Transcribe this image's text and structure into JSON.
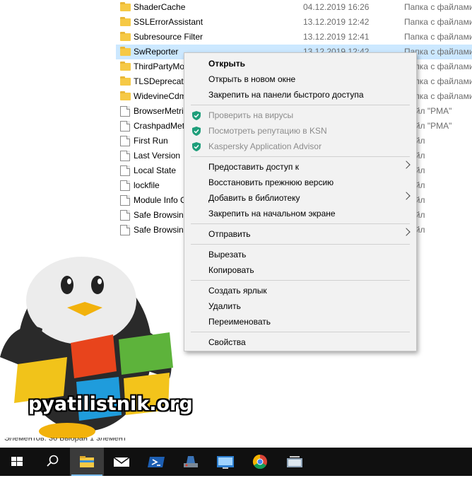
{
  "files": [
    {
      "name": "ShaderCache",
      "date": "04.12.2019 16:26",
      "type": "Папка с файлами",
      "kind": "folder"
    },
    {
      "name": "SSLErrorAssistant",
      "date": "13.12.2019 12:42",
      "type": "Папка с файлами",
      "kind": "folder"
    },
    {
      "name": "Subresource Filter",
      "date": "13.12.2019 12:41",
      "type": "Папка с файлами",
      "kind": "folder"
    },
    {
      "name": "SwReporter",
      "date": "13.12.2019 12:42",
      "type": "Папка с файлами",
      "kind": "folder",
      "selected": true
    },
    {
      "name": "ThirdPartyMo",
      "date": "",
      "type": "Папка с файлами",
      "kind": "folder"
    },
    {
      "name": "TLSDeprecatio",
      "date": "",
      "type": "Папка с файлами",
      "kind": "folder"
    },
    {
      "name": "WidevineCdm",
      "date": "",
      "type": "Папка с файлами",
      "kind": "folder"
    },
    {
      "name": "BrowserMetric",
      "date": "",
      "type": "Файл \"PMA\"",
      "kind": "file"
    },
    {
      "name": "CrashpadMetr",
      "date": "",
      "type": "Файл \"PMA\"",
      "kind": "file"
    },
    {
      "name": "First Run",
      "date": "",
      "type": "Файл",
      "kind": "file"
    },
    {
      "name": "Last Version",
      "date": "",
      "type": "Файл",
      "kind": "file"
    },
    {
      "name": "Local State",
      "date": "",
      "type": "Файл",
      "kind": "file"
    },
    {
      "name": "lockfile",
      "date": "",
      "type": "Файл",
      "kind": "file"
    },
    {
      "name": "Module Info C",
      "date": "",
      "type": "Файл",
      "kind": "file"
    },
    {
      "name": "Safe Browsing",
      "date": "",
      "type": "Файл",
      "kind": "file"
    },
    {
      "name": "Safe Browsing",
      "date": "",
      "type": "Файл",
      "kind": "file"
    }
  ],
  "context_menu": {
    "items": [
      {
        "label": "Открыть",
        "bold": true
      },
      {
        "label": "Открыть в новом окне"
      },
      {
        "label": "Закрепить на панели быстрого доступа"
      },
      {
        "separator": true
      },
      {
        "label": "Проверить на вирусы",
        "disabled": true,
        "icon": "kaspersky-shield-icon"
      },
      {
        "label": "Посмотреть репутацию в KSN",
        "disabled": true,
        "icon": "kaspersky-shield-icon"
      },
      {
        "label": "Kaspersky Application Advisor",
        "disabled": true,
        "icon": "kaspersky-shield-icon"
      },
      {
        "separator": true
      },
      {
        "label": "Предоставить доступ к",
        "submenu": true
      },
      {
        "label": "Восстановить прежнюю версию"
      },
      {
        "label": "Добавить в библиотеку",
        "submenu": true
      },
      {
        "label": "Закрепить на начальном экране"
      },
      {
        "separator": true
      },
      {
        "label": "Отправить",
        "submenu": true
      },
      {
        "separator": true
      },
      {
        "label": "Вырезать"
      },
      {
        "label": "Копировать"
      },
      {
        "separator": true
      },
      {
        "label": "Создать ярлык"
      },
      {
        "label": "Удалить"
      },
      {
        "label": "Переименовать"
      },
      {
        "separator": true
      },
      {
        "label": "Свойства"
      }
    ]
  },
  "status_bar": {
    "text": "Элементов: 36     Выбран 1 элемент"
  },
  "watermark": {
    "text": "pyatilistnik.org"
  },
  "taskbar": {
    "items": [
      {
        "icon": "windows-start-icon"
      },
      {
        "icon": "search-icon"
      },
      {
        "icon": "file-explorer-icon",
        "active": true
      },
      {
        "icon": "mail-icon"
      },
      {
        "icon": "powershell-icon"
      },
      {
        "icon": "server-manager-icon"
      },
      {
        "icon": "remote-desktop-icon"
      },
      {
        "icon": "chrome-icon"
      },
      {
        "icon": "network-app-icon"
      }
    ]
  },
  "colors": {
    "selection": "#cce8ff",
    "menu_bg": "#f2f2f2",
    "taskbar_bg": "#101010",
    "kaspersky": "#1e9e7a"
  }
}
